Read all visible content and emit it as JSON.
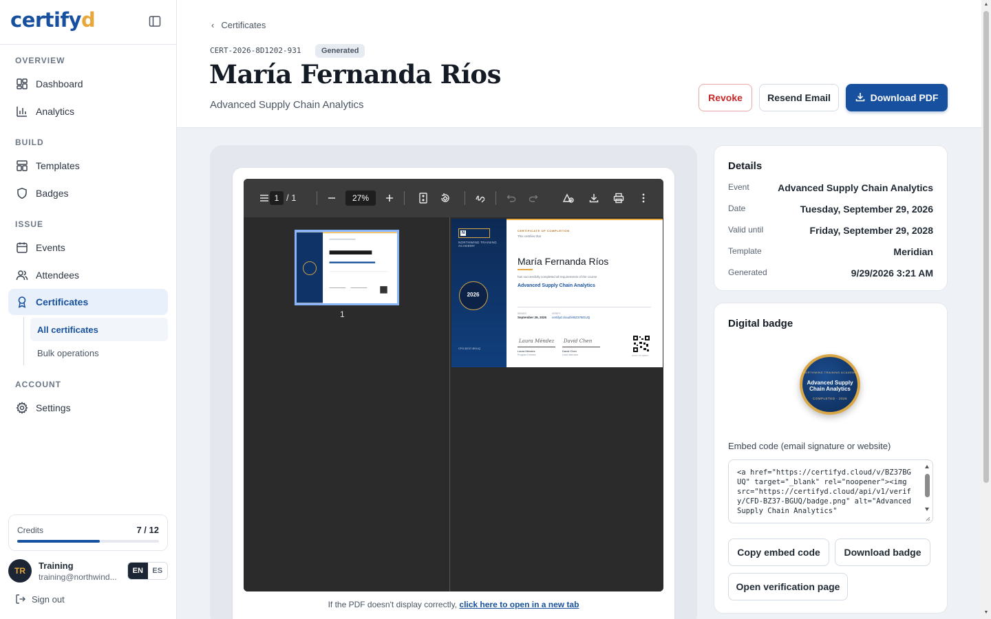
{
  "sidebar": {
    "logo_main": "certify",
    "logo_accent": "d",
    "sections": {
      "overview": "OVERVIEW",
      "build": "BUILD",
      "issue": "ISSUE",
      "account": "ACCOUNT"
    },
    "items": {
      "dashboard": "Dashboard",
      "analytics": "Analytics",
      "templates": "Templates",
      "badges": "Badges",
      "events": "Events",
      "attendees": "Attendees",
      "certificates": "Certificates",
      "settings": "Settings"
    },
    "sub_items": {
      "all_certificates": "All certificates",
      "bulk_operations": "Bulk operations"
    },
    "credits": {
      "label": "Credits",
      "value": "7 / 12",
      "used_fraction": 0.583
    },
    "user": {
      "initials": "TR",
      "name": "Training",
      "email": "training@northwind..."
    },
    "lang": {
      "en": "EN",
      "es": "ES"
    },
    "sign_out": "Sign out"
  },
  "header": {
    "breadcrumb": "Certificates",
    "cert_id": "CERT-2026-8D1202-931",
    "status": "Generated",
    "title": "María Fernanda Ríos",
    "subtitle": "Advanced Supply Chain Analytics",
    "buttons": {
      "revoke": "Revoke",
      "resend": "Resend Email",
      "download": "Download PDF"
    }
  },
  "viewer": {
    "page_current": "1",
    "page_total": "/ 1",
    "zoom": "27%",
    "thumb_page_label": "1",
    "footer_text": "If the PDF doesn't display correctly,",
    "footer_link": "click here to open in a new tab",
    "certificate": {
      "eyebrow": "CERTIFICATE OF COMPLETION",
      "certifies": "This certifies that",
      "name": "María Fernanda Ríos",
      "completed_text": "has successfully completed all requirements of the course",
      "course": "Advanced Supply Chain Analytics",
      "date_label": "ISSUED",
      "date": "September 29, 2026",
      "verify_label": "VERIFY",
      "verify": "certifyd.cloud/v/BZ37BGUQ",
      "academy": "NORTHWIND TRAINING ACADEMY",
      "seal_year": "2026",
      "sig1_name": "Laura Méndez",
      "sig1_role": "Program Director",
      "sig2_name": "David Chen",
      "sig2_role": "Lead Instructor",
      "credential": "CFD-BZ37-BGUQ",
      "scan": "SCAN TO VERIFY"
    }
  },
  "details": {
    "title": "Details",
    "rows": [
      {
        "label": "Event",
        "value": "Advanced Supply Chain Analytics"
      },
      {
        "label": "Date",
        "value": "Tuesday, September 29, 2026"
      },
      {
        "label": "Valid until",
        "value": "Friday, September 29, 2028"
      },
      {
        "label": "Template",
        "value": "Meridian"
      },
      {
        "label": "Generated",
        "value": "9/29/2026 3:21 AM"
      }
    ]
  },
  "badge": {
    "title": "Digital badge",
    "top_text": "NORTHWIND TRAINING ACADEMY",
    "center_text": "Advanced Supply Chain Analytics",
    "bottom_text": "COMPLETED · 2026",
    "embed_label": "Embed code (email signature or website)",
    "embed_code": "<a href=\"https://certifyd.cloud/v/BZ37BGUQ\" target=\"_blank\" rel=\"noopener\"><img src=\"https://certifyd.cloud/api/v1/verify/CFD-BZ37-BGUQ/badge.png\" alt=\"Advanced Supply Chain Analytics\"",
    "buttons": {
      "copy": "Copy embed code",
      "download": "Download badge",
      "open": "Open verification page"
    }
  },
  "colors": {
    "brand": "#17509e",
    "accent": "#e8a73a",
    "danger": "#c62828"
  }
}
